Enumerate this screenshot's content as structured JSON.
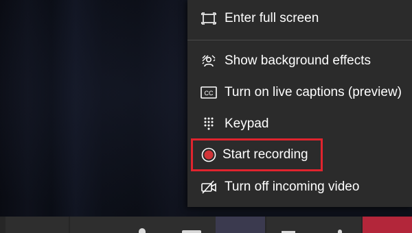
{
  "menu": {
    "items": [
      {
        "id": "fullscreen",
        "label": "Enter full screen",
        "icon": "fullscreen-icon"
      },
      {
        "id": "background",
        "label": "Show background effects",
        "icon": "background-effects-icon"
      },
      {
        "id": "captions",
        "label": "Turn on live captions (preview)",
        "icon": "closed-captions-icon"
      },
      {
        "id": "keypad",
        "label": "Keypad",
        "icon": "keypad-icon"
      },
      {
        "id": "record",
        "label": "Start recording",
        "icon": "record-icon"
      },
      {
        "id": "video",
        "label": "Turn off incoming video",
        "icon": "video-off-icon"
      }
    ]
  },
  "colors": {
    "menu_bg": "#2b2b2b",
    "highlight": "#e0242e",
    "record_dot": "#d13438",
    "hangup": "#b3263a",
    "active_tab": "#3b3a4f"
  }
}
